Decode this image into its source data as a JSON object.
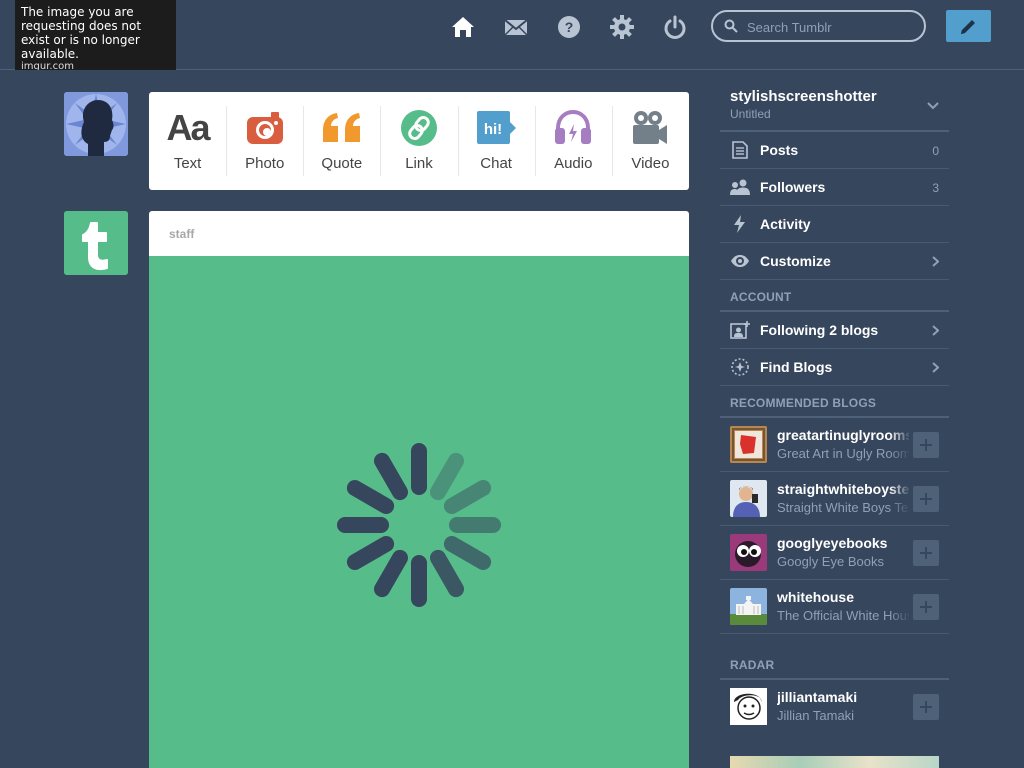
{
  "notice": {
    "text": "The image you are requesting does not exist or is no longer available.",
    "footer": "imgur.com"
  },
  "header": {
    "icons": [
      "home-icon",
      "mail-icon",
      "help-icon",
      "gear-icon",
      "power-icon"
    ],
    "search_placeholder": "Search Tumblr",
    "compose_icon": "pencil-icon"
  },
  "post_types": [
    {
      "label": "Text",
      "icon": "text-icon",
      "color": "#444444"
    },
    {
      "label": "Photo",
      "icon": "camera-icon",
      "color": "#d95e40"
    },
    {
      "label": "Quote",
      "icon": "quote-icon",
      "color": "#f2992e"
    },
    {
      "label": "Link",
      "icon": "link-icon",
      "color": "#56bc8a"
    },
    {
      "label": "Chat",
      "icon": "chat-icon",
      "color": "#529ecc"
    },
    {
      "label": "Audio",
      "icon": "headphones-icon",
      "color": "#a77dc2"
    },
    {
      "label": "Video",
      "icon": "video-camera-icon",
      "color": "#748089"
    }
  ],
  "post": {
    "author": "staff",
    "loading": true,
    "bg_color": "#56bc8a"
  },
  "sidebar": {
    "blog": {
      "name": "stylishscreenshotter",
      "subtitle": "Untitled"
    },
    "items": [
      {
        "label": "Posts",
        "count": "0",
        "icon": "posts-icon"
      },
      {
        "label": "Followers",
        "count": "3",
        "icon": "followers-icon"
      },
      {
        "label": "Activity",
        "icon": "lightning-icon"
      },
      {
        "label": "Customize",
        "icon": "eye-icon",
        "chevron": true
      }
    ],
    "account_heading": "ACCOUNT",
    "account_items": [
      {
        "label": "Following 2 blogs",
        "icon": "following-icon"
      },
      {
        "label": "Find Blogs",
        "icon": "compass-icon"
      }
    ],
    "recommended_heading": "RECOMMENDED BLOGS",
    "recommended": [
      {
        "name": "greatartinuglyrooms",
        "desc": "Great Art in Ugly Rooms"
      },
      {
        "name": "straightwhiteboystexting",
        "desc": "Straight White Boys Texting"
      },
      {
        "name": "googlyeyebooks",
        "desc": "Googly Eye Books"
      },
      {
        "name": "whitehouse",
        "desc": "The Official White House"
      }
    ],
    "radar_heading": "RADAR",
    "radar": [
      {
        "name": "jilliantamaki",
        "desc": "Jillian Tamaki"
      }
    ]
  },
  "colors": {
    "background": "#36465d",
    "accent": "#529ecc",
    "staff_green": "#56bc8a"
  }
}
